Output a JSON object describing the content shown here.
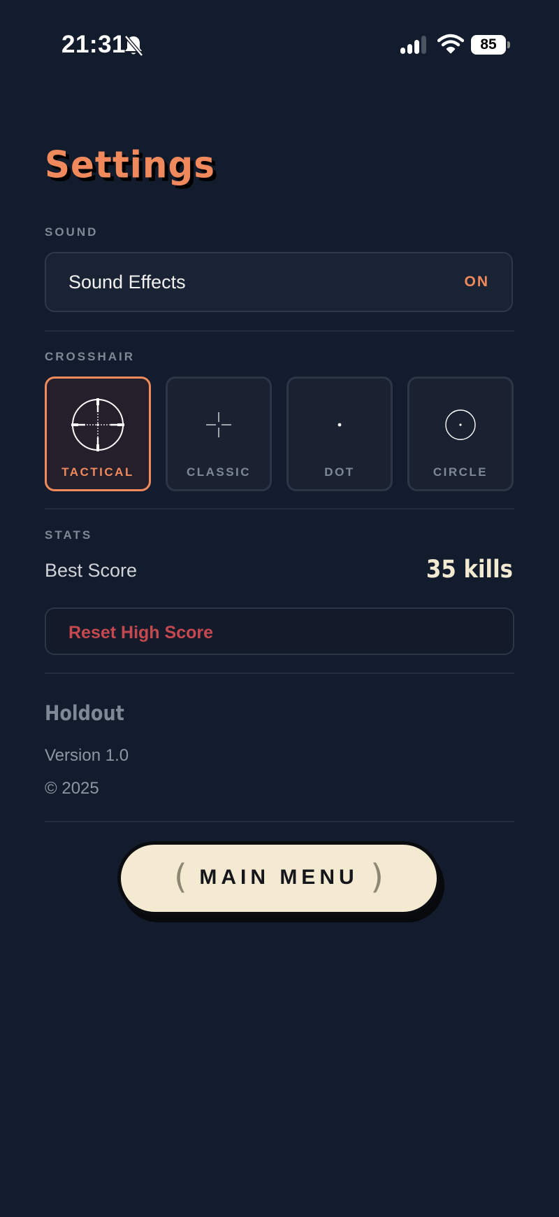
{
  "status_bar": {
    "time": "21:31",
    "battery": "85",
    "icons": [
      "bell-slash-icon",
      "signal-icon",
      "wifi-icon",
      "battery-icon"
    ]
  },
  "page": {
    "title": "Settings"
  },
  "sound": {
    "section_label": "SOUND",
    "row_label": "Sound Effects",
    "row_value": "ON"
  },
  "crosshair": {
    "section_label": "CROSSHAIR",
    "selected": "TACTICAL",
    "options": [
      {
        "label": "TACTICAL",
        "icon": "tactical-crosshair-icon"
      },
      {
        "label": "CLASSIC",
        "icon": "classic-crosshair-icon"
      },
      {
        "label": "DOT",
        "icon": "dot-crosshair-icon"
      },
      {
        "label": "CIRCLE",
        "icon": "circle-crosshair-icon"
      }
    ]
  },
  "stats": {
    "section_label": "STATS",
    "best_label": "Best Score",
    "best_value": "35 kills",
    "reset_label": "Reset High Score"
  },
  "about": {
    "app_name": "Holdout",
    "version": "Version 1.0",
    "copyright": "© 2025"
  },
  "footer": {
    "main_menu_label": "MAIN MENU",
    "left_bracket": "(",
    "right_bracket": ")"
  },
  "colors": {
    "background": "#131c2c",
    "accent": "#f08a5d",
    "danger": "#c6484f",
    "button_cream": "#f3ead1",
    "muted": "#7f8896"
  }
}
